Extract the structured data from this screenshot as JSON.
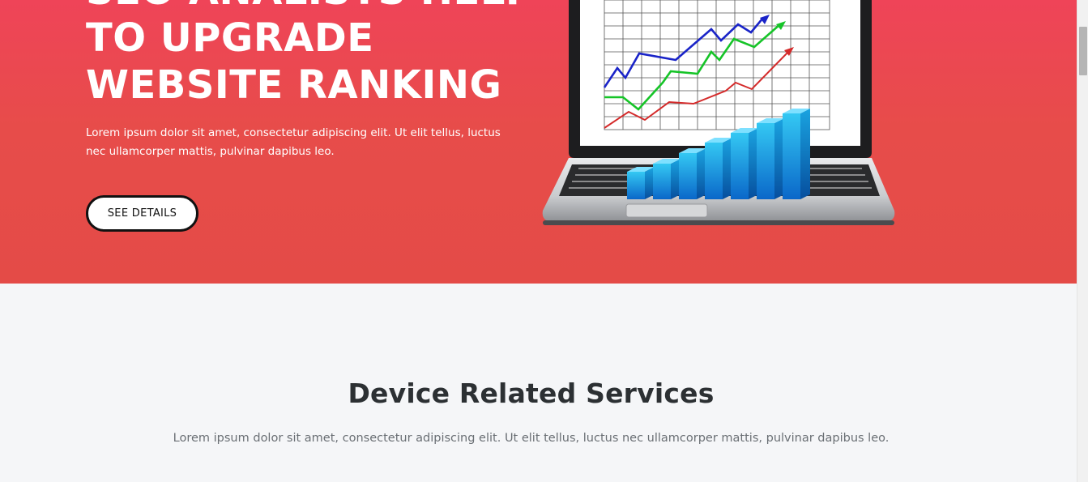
{
  "hero": {
    "title_lines": [
      "SEO ANALISTS HELP",
      "TO UPGRADE",
      "WEBSITE RANKING"
    ],
    "description": "Lorem ipsum dolor sit amet, consectetur adipiscing elit. Ut elit tellus, luctus nec ullamcorper mattis, pulvinar dapibus leo.",
    "cta_label": "SEE DETAILS",
    "image_icon": "laptop-growth-chart-illustration"
  },
  "services": {
    "title": "Device Related Services",
    "description": "Lorem ipsum dolor sit amet, consectetur adipiscing elit. Ut elit tellus, luctus nec ullamcorper mattis, pulvinar dapibus leo."
  },
  "colors": {
    "hero_top": "#ef4458",
    "hero_bottom": "#e44b47",
    "section_bg": "#f5f6f8",
    "heading_dark": "#2c3033",
    "body_gray": "#6a6f74"
  }
}
